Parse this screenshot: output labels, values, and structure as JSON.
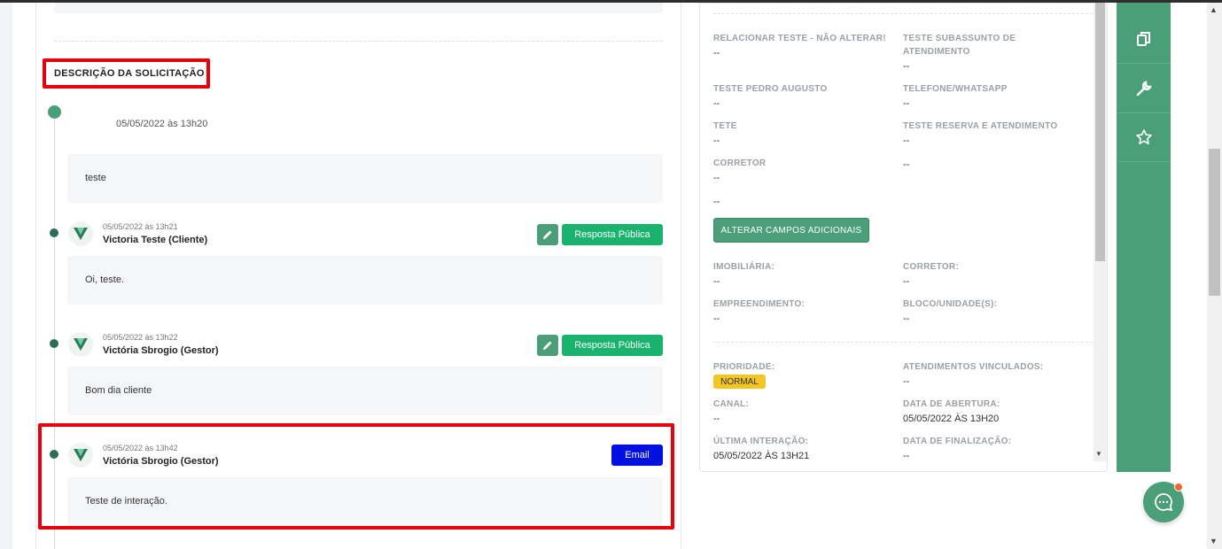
{
  "section_title": "DESCRIÇÃO DA SOLICITAÇÃO",
  "timeline": {
    "first_entry": {
      "date": "05/05/2022 às 13h20",
      "message": "teste"
    },
    "items": [
      {
        "date": "05/05/2022 às 13h21",
        "author": "Victoria Teste (Cliente)",
        "action_label": "Resposta Pública",
        "message": "Oi, teste."
      },
      {
        "date": "05/05/2022 às 13h22",
        "author": "Victória Sbrogio (Gestor)",
        "action_label": "Resposta Pública",
        "message": "Bom dia cliente"
      },
      {
        "date": "05/05/2022 às 13h42",
        "author": "Victória Sbrogio (Gestor)",
        "action_label": "Email",
        "message": "Teste de interação."
      }
    ]
  },
  "details": {
    "custom_fields": [
      {
        "label": "RELACIONAR TESTE - NÃO ALTERAR!",
        "value": "--"
      },
      {
        "label": "TESTE SUBASSUNTO DE ATENDIMENTO",
        "value": "--"
      },
      {
        "label": "TESTE PEDRO AUGUSTO",
        "value": "--"
      },
      {
        "label": "TELEFONE/WHATSAPP",
        "value": "--"
      },
      {
        "label": "TETE",
        "value": "--"
      },
      {
        "label": "TESTE RESERVA E ATENDIMENTO",
        "value": "--"
      },
      {
        "label": "CORRETOR",
        "value": "--"
      },
      {
        "label": "",
        "value": "--"
      },
      {
        "label": "",
        "value": "--"
      }
    ],
    "alter_button": "ALTERAR CAMPOS ADICIONAIS",
    "property_fields": [
      {
        "label": "IMOBILIÁRIA:",
        "value": "--"
      },
      {
        "label": "CORRETOR:",
        "value": "--"
      },
      {
        "label": "EMPREENDIMENTO:",
        "value": "--"
      },
      {
        "label": "BLOCO/UNIDADE(S):",
        "value": "--"
      }
    ],
    "status_fields": [
      {
        "label": "PRIORIDADE:",
        "value": "NORMAL"
      },
      {
        "label": "ATENDIMENTOS VINCULADOS:",
        "value": "--"
      },
      {
        "label": "CANAL:",
        "value": "--"
      },
      {
        "label": "DATA DE ABERTURA:",
        "value": "05/05/2022 ÀS 13H20"
      },
      {
        "label": "ÚLTIMA INTERAÇÃO:",
        "value": "05/05/2022 ÀS 13H21"
      },
      {
        "label": "DATA DE FINALIZAÇÃO:",
        "value": "--"
      }
    ]
  },
  "side_actions": [
    "copy-icon",
    "wrench-icon",
    "star-icon"
  ],
  "colors": {
    "brand_green": "#4a9e78",
    "public_reply": "#1ab36e",
    "email": "#0010e0",
    "priority_badge": "#f3c623",
    "highlight": "#e8000b"
  }
}
